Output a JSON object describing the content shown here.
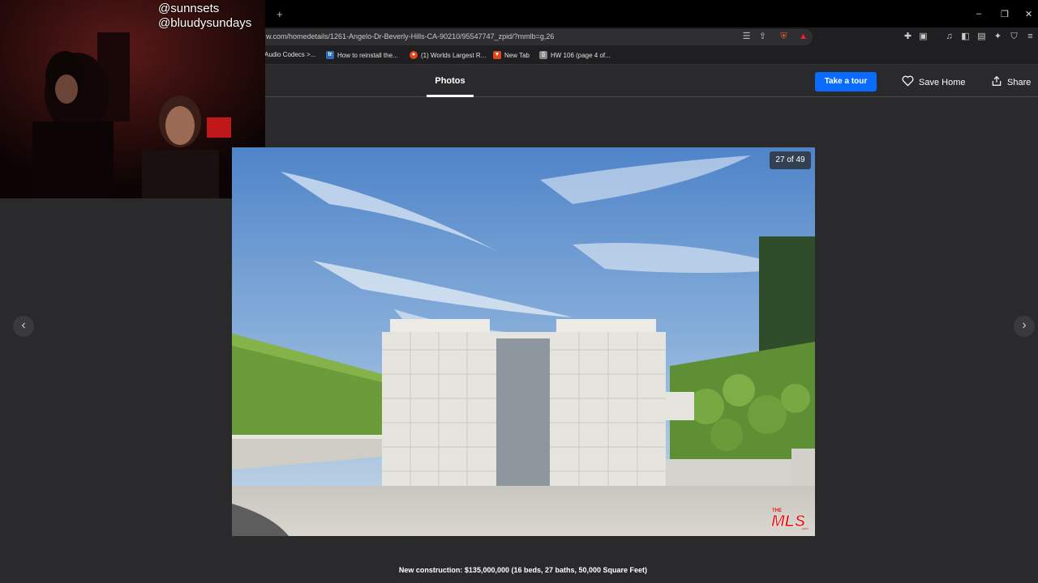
{
  "browser": {
    "new_tab_symbol": "+",
    "window_controls": [
      "–",
      "❐",
      "✕"
    ],
    "url": "w.com/homedetails/1261-Angelo-Dr-Beverly-Hills-CA-90210/95547747_zpid/?mmlb=g,26",
    "bookmarks": [
      {
        "label": "Audio Codecs >...",
        "icon": "none",
        "color": ""
      },
      {
        "label": "How to reinstall the...",
        "icon": "tr",
        "color": "#2a6fb3"
      },
      {
        "label": "(1) Worlds Largest R...",
        "icon": "reddit-icon",
        "color": "#e0451d"
      },
      {
        "label": "New Tab",
        "icon": "brave-icon",
        "color": "#e0451d"
      },
      {
        "label": "HW 106 (page 4 of...",
        "icon": "document-icon",
        "color": "#999"
      }
    ]
  },
  "header": {
    "tab_photos": "Photos",
    "take_tour": "Take a tour",
    "save_home": "Save Home",
    "share": "Share"
  },
  "overlay": {
    "handle_1": "@sunnsets",
    "handle_2": "@bluudysundays"
  },
  "viewer": {
    "counter": "27 of 49",
    "watermark": "THE MLS .com",
    "prev_icon": "‹",
    "next_icon": "›",
    "caption": "New construction: $135,000,000 (16 beds, 27 baths, 50,000 Square Feet)"
  },
  "colors": {
    "accent": "#0a6cff",
    "background": "#2a2a2c"
  }
}
